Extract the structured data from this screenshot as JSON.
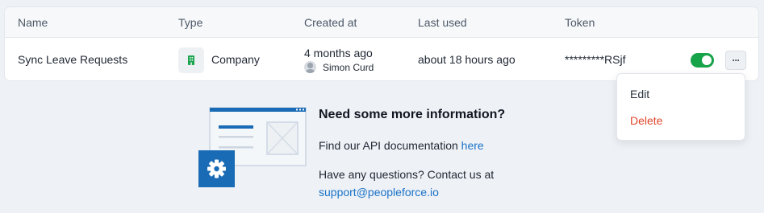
{
  "table": {
    "headers": {
      "name": "Name",
      "type": "Type",
      "created_at": "Created at",
      "last_used": "Last used",
      "token": "Token"
    },
    "rows": [
      {
        "name": "Sync Leave Requests",
        "type": "Company",
        "created_ago": "4 months ago",
        "created_by": "Simon Curd",
        "last_used": "about 18 hours ago",
        "token": "*********RSjf",
        "enabled": true
      }
    ]
  },
  "row_menu": {
    "more_label": "···",
    "edit": "Edit",
    "delete": "Delete"
  },
  "info": {
    "title": "Need some more information?",
    "docs_text": "Find our API documentation",
    "docs_link": "here",
    "questions_text": "Have any questions? Contact us at",
    "support_email": "support@peopleforce.io"
  },
  "colors": {
    "accent": "#1a73c9",
    "toggle_on": "#17a34a",
    "delete": "#e0462c",
    "building_icon": "#1aa64f"
  }
}
